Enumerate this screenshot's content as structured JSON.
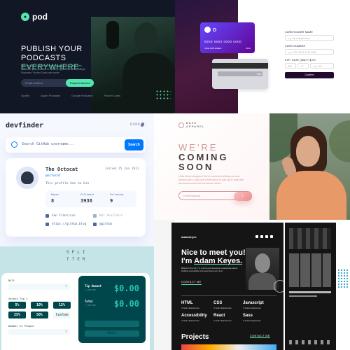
{
  "pod": {
    "logo": "pod",
    "headline_1": "PUBLISH YOUR PODCASTS",
    "headline_2": "EVERYWHERE.",
    "description": "Upload your audio to Pod with a single click. We'll then distribute your podcast to Spotify, Apple Podcasts, Google Podcasts, Pocket Casts and more!",
    "email_placeholder": "Email address",
    "cta": "Request Access",
    "brands": [
      "Spotify",
      "Apple Podcasts",
      "Google Podcasts",
      "Pocket Casts"
    ],
    "accent": "#54e6af"
  },
  "card": {
    "number": "0000 0000 0000 0000",
    "name": "JANE APPLESEED",
    "expiry": "00/00",
    "cvc": "000",
    "labels": {
      "cardholder": "CARDHOLDER NAME",
      "cardnumber": "CARD NUMBER",
      "exp": "EXP. DATE (MM/YY)",
      "cvc": "CVC"
    },
    "placeholders": {
      "name": "e.g. Jane Appleseed",
      "number": "e.g. 1234 5678 9123 0000",
      "mm": "MM",
      "yy": "YY",
      "cvc": "e.g. 123"
    },
    "confirm": "Confirm"
  },
  "devfinder": {
    "brand": "devfinder",
    "mode": "DARK",
    "search_placeholder": "Search GitHub username...",
    "search_button": "Search",
    "name": "The Octocat",
    "handle": "@octocat",
    "joined": "Joined 25 Jan 2011",
    "bio": "This profile has no bio",
    "stats": [
      {
        "label": "Repos",
        "value": "8"
      },
      {
        "label": "Followers",
        "value": "3938"
      },
      {
        "label": "Following",
        "value": "9"
      }
    ],
    "links": {
      "location": "San Francisco",
      "twitter": "Not Available",
      "blog": "https://github.blog",
      "company": "@github"
    }
  },
  "base": {
    "logo_1": "BASE",
    "logo_2": "APPAREL",
    "h_1": "WE'RE",
    "h_2": "COMING",
    "h_3": "SOON",
    "desc": "Hello fellow shoppers! We're currently building our new fashion store. Add your email below to stay up-to-date with announcements and our launch deals.",
    "email_placeholder": "Email Address",
    "submit_arrow": "›"
  },
  "splitter": {
    "logo": "SPLI\nTTER",
    "bill_label": "Bill",
    "bill_value": "0",
    "tip_label": "Select Tip %",
    "tips": [
      "5%",
      "10%",
      "15%",
      "25%",
      "50%",
      "Custom"
    ],
    "people_label": "Number of People",
    "people_value": "0",
    "tip_amount_label": "Tip Amount",
    "total_label": "Total",
    "per_person": "/ person",
    "tip_amount": "$0.00",
    "total": "$0.00",
    "reset": "RESET"
  },
  "adam": {
    "nav": "adamkeyes",
    "headline_1": "Nice to meet you!",
    "headline_2": "I'm ",
    "headline_name": "Adam Keyes.",
    "description": "Based in the UK, I'm a front-end developer passionate about building accessible web apps that users love.",
    "contact": "CONTACT ME",
    "skills": [
      {
        "name": "HTML",
        "exp": "4 Years Experience"
      },
      {
        "name": "CSS",
        "exp": "4 Years Experience"
      },
      {
        "name": "Javascript",
        "exp": "4 Years Experience"
      },
      {
        "name": "Accessibility",
        "exp": "4 Years Experience"
      },
      {
        "name": "React",
        "exp": "3 Years Experience"
      },
      {
        "name": "Sass",
        "exp": "3 Years Experience"
      }
    ],
    "projects": "Projects",
    "projects_cta": "CONTACT ME",
    "accent": "#4ee1a0"
  }
}
